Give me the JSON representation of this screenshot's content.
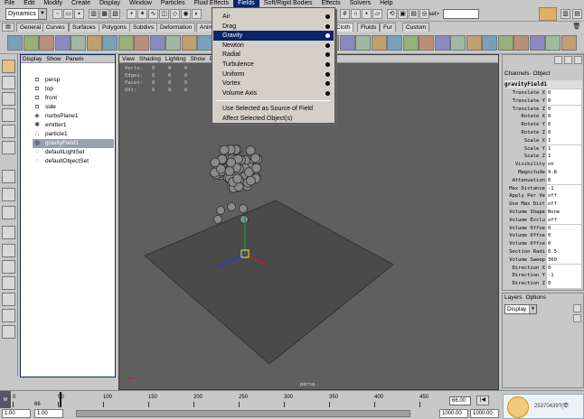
{
  "menubar": [
    "File",
    "Edit",
    "Modify",
    "Create",
    "Display",
    "Window",
    "Particles",
    "Fluid Effects",
    "Fields",
    "Soft/Rigid Bodies",
    "Effects",
    "Solvers",
    "Help"
  ],
  "mode_selector": "Dynamics",
  "sel_label": "sel>",
  "shelf_tabs": [
    "General",
    "Curves",
    "Surfaces",
    "Polygons",
    "Subdivs",
    "Deformation",
    "Anim",
    "Cloth",
    "Fluids",
    "Fur",
    "Custom"
  ],
  "active_shelf_tab": "Cloth",
  "outliner": {
    "menu": [
      "Display",
      "Show",
      "Panels"
    ],
    "items": [
      {
        "label": "persp",
        "icon": "camera-icon"
      },
      {
        "label": "top",
        "icon": "camera-icon"
      },
      {
        "label": "front",
        "icon": "camera-icon"
      },
      {
        "label": "side",
        "icon": "camera-icon"
      },
      {
        "label": "nurbsPlane1",
        "icon": "nurbs-icon"
      },
      {
        "label": "emitter1",
        "icon": "emitter-icon"
      },
      {
        "label": "particle1",
        "icon": "particle-icon"
      },
      {
        "label": "gravityField1",
        "icon": "field-icon",
        "selected": true
      },
      {
        "label": "defaultLightSet",
        "icon": "set-icon"
      },
      {
        "label": "defaultObjectSet",
        "icon": "set-icon"
      }
    ]
  },
  "viewport": {
    "menu": [
      "View",
      "Shading",
      "Lighting",
      "Show",
      "Panels"
    ],
    "hud": [
      {
        "label": "Verts:",
        "values": [
          "0",
          "0",
          "0"
        ]
      },
      {
        "label": "Edges:",
        "values": [
          "0",
          "0",
          "0"
        ]
      },
      {
        "label": "Faces:",
        "values": [
          "0",
          "0",
          "0"
        ]
      },
      {
        "label": "UVs:",
        "values": [
          "0",
          "0",
          "0"
        ]
      }
    ],
    "camera": "persp"
  },
  "fields_menu": {
    "items": [
      {
        "label": "Air",
        "option": true
      },
      {
        "label": "Drag",
        "option": true
      },
      {
        "label": "Gravity",
        "option": true,
        "highlighted": true
      },
      {
        "label": "Newton",
        "option": true
      },
      {
        "label": "Radial",
        "option": true
      },
      {
        "label": "Turbulence",
        "option": true
      },
      {
        "label": "Uniform",
        "option": true
      },
      {
        "label": "Vortex",
        "option": true
      },
      {
        "label": "Volume Axis",
        "option": true
      }
    ],
    "items2": [
      {
        "label": "Use Selected as Source of Field"
      },
      {
        "label": "Affect Selected Object(s)"
      }
    ]
  },
  "channel_box": {
    "menu": [
      "Channels",
      "Object"
    ],
    "title": "gravityField1",
    "rows": [
      {
        "label": "Translate X",
        "value": "0"
      },
      {
        "label": "Translate Y",
        "value": "0"
      },
      {
        "label": "Translate Z",
        "value": "0"
      },
      {
        "label": "Rotate X",
        "value": "0"
      },
      {
        "label": "Rotate Y",
        "value": "0"
      },
      {
        "label": "Rotate Z",
        "value": "0"
      },
      {
        "label": "Scale X",
        "value": "1"
      },
      {
        "label": "Scale Y",
        "value": "1"
      },
      {
        "label": "Scale Z",
        "value": "1"
      },
      {
        "label": "Visibility",
        "value": "on"
      },
      {
        "label": "Magnitude",
        "value": "9.8"
      },
      {
        "label": "Attenuation",
        "value": "0"
      },
      {
        "label": "Max Distance",
        "value": "-1"
      },
      {
        "label": "Apply Per Ve",
        "value": "off"
      },
      {
        "label": "Use Max Dist",
        "value": "off"
      },
      {
        "label": "Volume Shape",
        "value": "None"
      },
      {
        "label": "Volume Exclu",
        "value": "off"
      },
      {
        "label": "Volume Offse",
        "value": "0"
      },
      {
        "label": "Volume Offse",
        "value": "0"
      },
      {
        "label": "Volume Offse",
        "value": "0"
      },
      {
        "label": "Section Radi",
        "value": "0.5"
      },
      {
        "label": "Volume Sweep",
        "value": "360"
      },
      {
        "label": "Direction X",
        "value": "0"
      },
      {
        "label": "Direction Y",
        "value": "-1"
      },
      {
        "label": "Direction Z",
        "value": "0"
      }
    ]
  },
  "layers": {
    "menu": [
      "Layers",
      "Options"
    ],
    "display": "Display"
  },
  "timeslider": {
    "ticks": [
      "0",
      "50",
      "100",
      "150",
      "200",
      "250",
      "300",
      "350",
      "400",
      "450"
    ],
    "start_mark": "66",
    "current_frame": "66.00"
  },
  "rangeslider": {
    "start": "1.00",
    "inner_start": "1.00",
    "inner_end": "1000.00",
    "end": "1000.00"
  },
  "qq_notice": "25370439?(牵"
}
